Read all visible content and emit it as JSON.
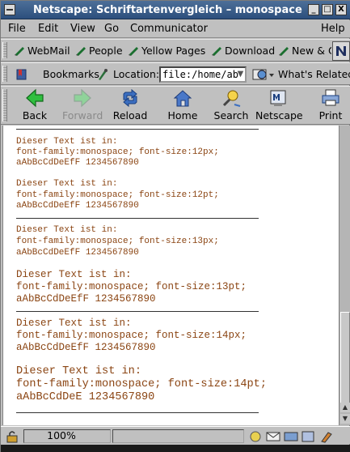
{
  "window": {
    "title": "Netscape: Schriftartenvergleich – monospace",
    "buttons": [
      "_",
      "□",
      "X"
    ]
  },
  "menu": [
    "File",
    "Edit",
    "View",
    "Go",
    "Communicator",
    "Help"
  ],
  "personal_toolbar": [
    "WebMail",
    "People",
    "Yellow Pages",
    "Download",
    "New & C"
  ],
  "location_bar": {
    "bookmarks_label": "Bookmarks",
    "location_label": "Location:",
    "url": "file:/home/ab",
    "whats_related": "What's Related"
  },
  "nav": {
    "back": "Back",
    "forward": "Forward",
    "reload": "Reload",
    "home": "Home",
    "search": "Search",
    "netscape": "Netscape",
    "print": "Print"
  },
  "content": {
    "blocks": [
      {
        "lines": [
          "Dieser Text ist in:",
          "font-family:monospace; font-size:12px;",
          "aAbBcCdDeEfF 1234567890"
        ]
      },
      {
        "lines": [
          "Dieser Text ist in:",
          "font-family:monospace; font-size:12pt;",
          "aAbBcCdDeEfF 1234567890"
        ]
      },
      {
        "lines": [
          "Dieser Text ist in:",
          "font-family:monospace; font-size:13px;",
          "aAbBcCdDeEfF 1234567890"
        ]
      },
      {
        "lines": [
          "Dieser Text ist in:",
          "font-family:monospace; font-size:13pt;",
          "aAbBcCdDeEfF 1234567890"
        ]
      },
      {
        "lines": [
          "Dieser Text ist in:",
          "font-family:monospace; font-size:14px;",
          "aAbBcCdDeEfF 1234567890"
        ]
      },
      {
        "lines": [
          "Dieser Text ist in:",
          "font-family:monospace; font-size:14pt;",
          "aAbBcCdDeE 1234567890"
        ]
      }
    ]
  },
  "status": {
    "zoom": "100%"
  },
  "colors": {
    "titlebar": "#2c4f7d",
    "content_text": "#8b4513",
    "chrome": "#c0c0c0"
  }
}
